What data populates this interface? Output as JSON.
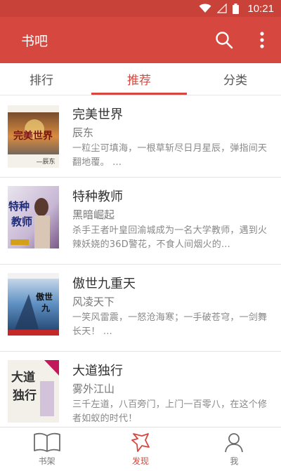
{
  "status_bar": {
    "time": "10:21"
  },
  "app_bar": {
    "title": "书吧"
  },
  "tabs": [
    {
      "label": "排行",
      "active": false
    },
    {
      "label": "推荐",
      "active": true
    },
    {
      "label": "分类",
      "active": false
    }
  ],
  "books": [
    {
      "title": "完美世界",
      "author": "辰东",
      "desc": "一粒尘可填海，一根草斩尽日月星辰，弹指间天翻地覆。 ...",
      "cover_text": "完美世界"
    },
    {
      "title": "特种教师",
      "author": "黑暗崛起",
      "desc": "杀手王者叶皇回渝城成为一名大学教师，遇到火辣妖娆的36D警花，不食人间烟火的...",
      "cover_text": "特种教师"
    },
    {
      "title": "傲世九重天",
      "author": "风凌天下",
      "desc": "一笑风雷震，一怒沧海寒；一手破苍穹，一剑舞长天！ ...",
      "cover_text": "傲世九重天"
    },
    {
      "title": "大道独行",
      "author": "雾外江山",
      "desc": "三千左道，八百旁门，上门一百零八，在这个修者如蚁的时代！",
      "cover_text": "大道独行"
    }
  ],
  "bottom_nav": [
    {
      "label": "书架",
      "icon": "book-icon",
      "active": false
    },
    {
      "label": "发现",
      "icon": "discover-icon",
      "active": true
    },
    {
      "label": "我",
      "icon": "person-icon",
      "active": false
    }
  ],
  "colors": {
    "primary": "#d6473f",
    "status_bar": "#c8423a"
  }
}
